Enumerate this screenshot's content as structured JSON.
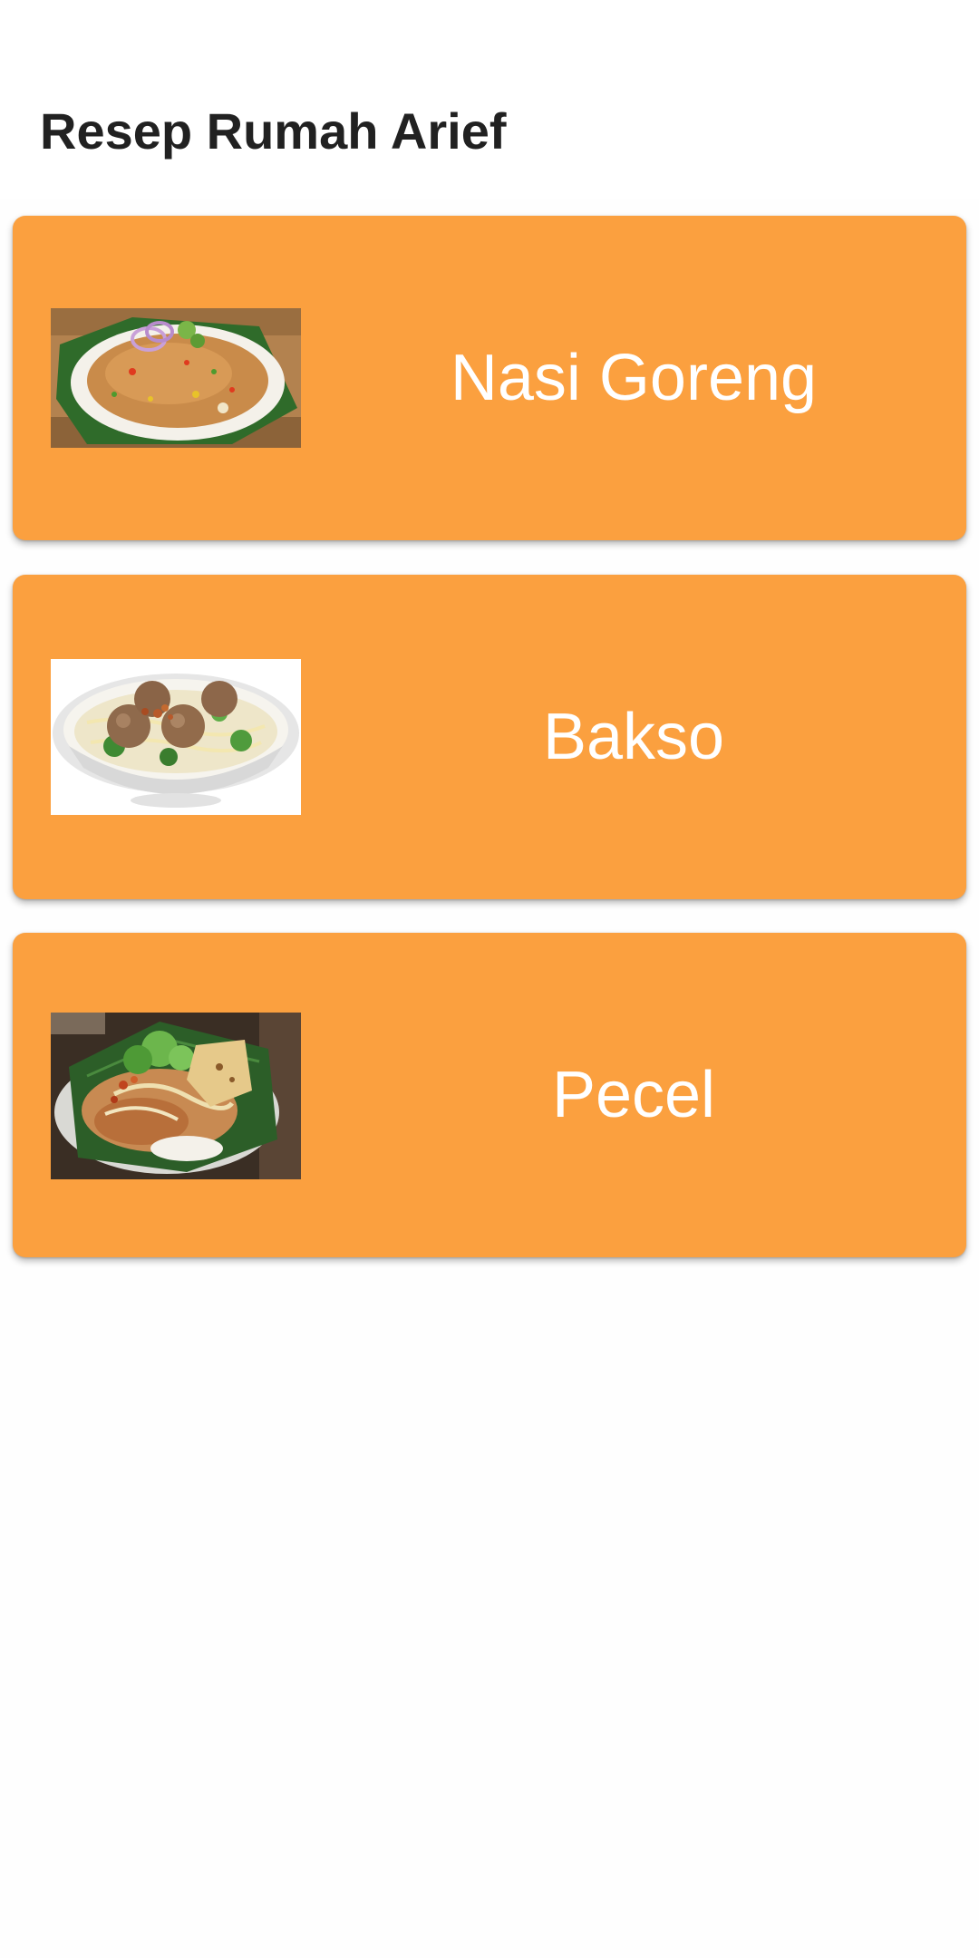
{
  "app_bar": {
    "title": "Resep Rumah Arief"
  },
  "recipes": [
    {
      "name": "Nasi Goreng",
      "image_icon": "fried-rice-image"
    },
    {
      "name": "Bakso",
      "image_icon": "meatball-soup-image"
    },
    {
      "name": "Pecel",
      "image_icon": "pecel-image"
    }
  ],
  "colors": {
    "card_background": "#fba03f",
    "card_text": "#ffffff",
    "title_text": "#212121",
    "page_background": "#fefefe"
  }
}
